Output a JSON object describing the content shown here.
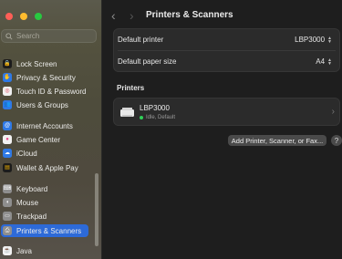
{
  "window": {
    "traffic_lights": [
      "close",
      "minimize",
      "zoom"
    ]
  },
  "sidebar": {
    "search_placeholder": "Search",
    "items": [
      {
        "label": "Lock Screen",
        "icon": "lock-icon",
        "color": "#1c1c1c",
        "glyph": "🔒"
      },
      {
        "label": "Privacy & Security",
        "icon": "hand-icon",
        "color": "#2f79e5",
        "glyph": "✋"
      },
      {
        "label": "Touch ID & Password",
        "icon": "fingerprint-icon",
        "color": "#f0f0f0",
        "glyph": "◎"
      },
      {
        "label": "Users & Groups",
        "icon": "users-icon",
        "color": "#2f79e5",
        "glyph": "👥"
      },
      {
        "label": "Internet Accounts",
        "icon": "at-icon",
        "color": "#2f79e5",
        "glyph": "@"
      },
      {
        "label": "Game Center",
        "icon": "game-center-icon",
        "color": "#f2f2f2",
        "glyph": "●"
      },
      {
        "label": "iCloud",
        "icon": "cloud-icon",
        "color": "#2f79e5",
        "glyph": "☁"
      },
      {
        "label": "Wallet & Apple Pay",
        "icon": "wallet-icon",
        "color": "#1c1c1c",
        "glyph": "▤"
      },
      {
        "label": "Keyboard",
        "icon": "keyboard-icon",
        "color": "#8e8e8e",
        "glyph": "⌨"
      },
      {
        "label": "Mouse",
        "icon": "mouse-icon",
        "color": "#8e8e8e",
        "glyph": "◖"
      },
      {
        "label": "Trackpad",
        "icon": "trackpad-icon",
        "color": "#8e8e8e",
        "glyph": "▭"
      },
      {
        "label": "Printers & Scanners",
        "icon": "printer-icon",
        "color": "#8e8e8e",
        "glyph": "⎙",
        "selected": true
      },
      {
        "label": "Java",
        "icon": "java-icon",
        "color": "#f2f2f2",
        "glyph": "☕"
      }
    ]
  },
  "main": {
    "title": "Printers & Scanners",
    "default_printer_label": "Default printer",
    "default_printer_value": "LBP3000",
    "default_paper_label": "Default paper size",
    "default_paper_value": "A4",
    "printers_section_title": "Printers",
    "printer": {
      "name": "LBP3000",
      "status": "Idle, Default",
      "status_color": "#30d158"
    },
    "add_button": "Add Printer, Scanner, or Fax...",
    "help_button": "?"
  }
}
